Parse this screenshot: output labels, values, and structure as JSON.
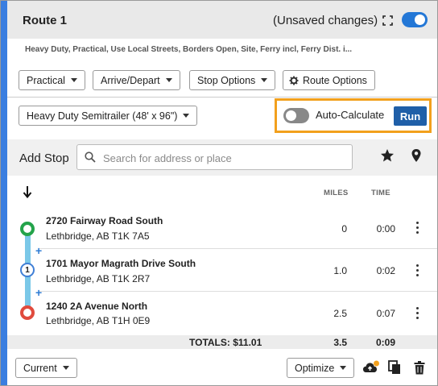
{
  "header": {
    "title": "Route 1",
    "status": "(Unsaved changes)",
    "accent_color": "#3a7ee0"
  },
  "route_options_summary": "Heavy Duty, Practical, Use Local Streets, Borders Open, Site, Ferry incl, Ferry Dist. i...",
  "toolbar": {
    "routing_type": "Practical",
    "arrive_depart": "Arrive/Depart",
    "stop_options": "Stop Options",
    "route_options": "Route Options"
  },
  "vehicle": {
    "profile": "Heavy Duty Semitrailer (48' x 96\")"
  },
  "auto_calculate": {
    "label": "Auto-Calculate",
    "enabled": false,
    "run_label": "Run",
    "highlight_color": "#f2a01d"
  },
  "add_stop": {
    "label": "Add Stop",
    "search_placeholder": "Search for address or place"
  },
  "columns": {
    "miles": "MILES",
    "time": "TIME"
  },
  "stops": [
    {
      "type": "origin",
      "name": "2720 Fairway Road South",
      "city": "Lethbridge, AB T1K 7A5",
      "miles": "0",
      "time": "0:00"
    },
    {
      "type": "waypoint",
      "marker": "1",
      "name": "1701 Mayor Magrath Drive South",
      "city": "Lethbridge, AB T1K 2R7",
      "miles": "1.0",
      "time": "0:02"
    },
    {
      "type": "destination",
      "name": "1240 2A Avenue North",
      "city": "Lethbridge, AB T1H 0E9",
      "miles": "2.5",
      "time": "0:07"
    }
  ],
  "insert_stop_symbol": "+",
  "totals": {
    "label": "TOTALS: $11.01",
    "miles": "3.5",
    "time": "0:09"
  },
  "footer": {
    "traffic_mode": "Current",
    "optimize": "Optimize"
  }
}
